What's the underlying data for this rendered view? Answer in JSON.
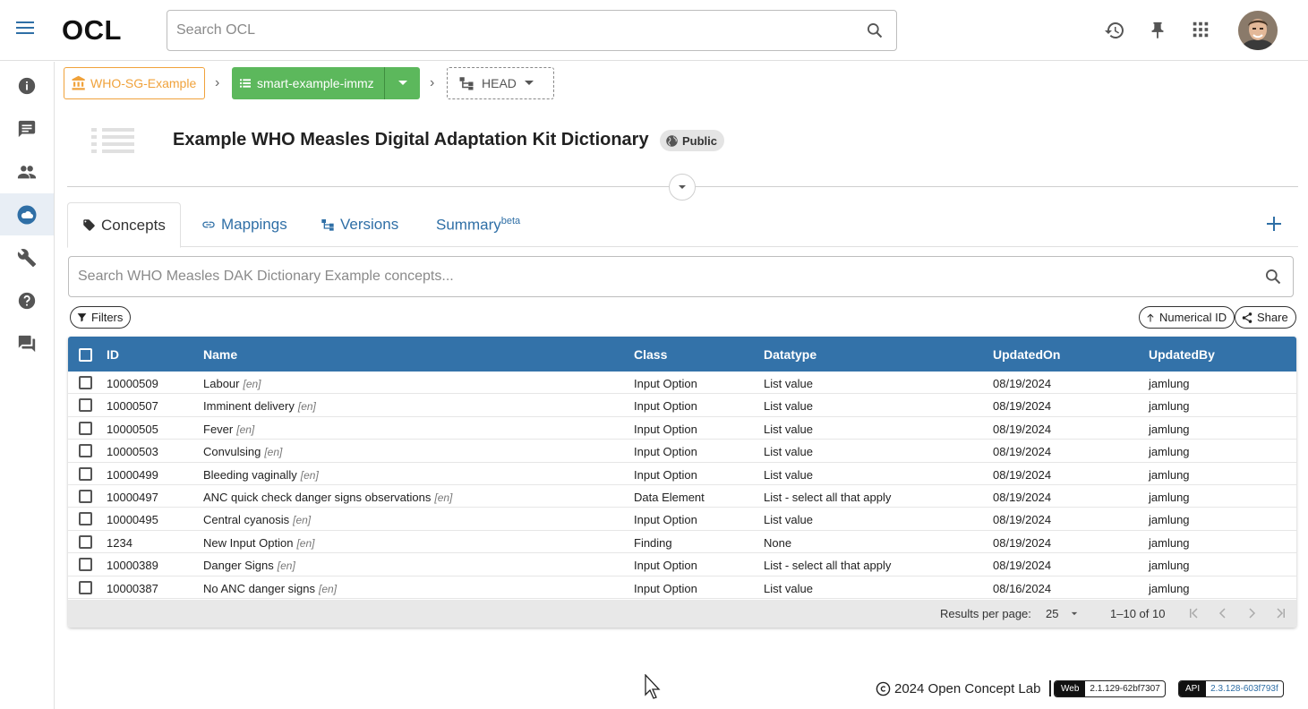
{
  "app": {
    "logo": "OCL"
  },
  "search": {
    "placeholder": "Search OCL"
  },
  "breadcrumb": {
    "org": "WHO-SG-Example",
    "source": "smart-example-immz",
    "version": "HEAD"
  },
  "header": {
    "title": "Example WHO Measles Digital Adaptation Kit Dictionary",
    "visibility": "Public"
  },
  "tabs": [
    {
      "label": "Concepts"
    },
    {
      "label": "Mappings"
    },
    {
      "label": "Versions"
    },
    {
      "label": "Summary",
      "sup": "beta"
    }
  ],
  "concept_search": {
    "placeholder": "Search WHO Measles DAK Dictionary Example concepts..."
  },
  "chips": {
    "filters": "Filters",
    "sort": "Numerical ID",
    "share": "Share"
  },
  "table": {
    "columns": [
      "ID",
      "Name",
      "Class",
      "Datatype",
      "UpdatedOn",
      "UpdatedBy"
    ],
    "rows": [
      {
        "id": "10000509",
        "name": "Labour",
        "lang": "[en]",
        "class": "Input Option",
        "datatype": "List value",
        "updated_on": "08/19/2024",
        "updated_by": "jamlung"
      },
      {
        "id": "10000507",
        "name": "Imminent delivery",
        "lang": "[en]",
        "class": "Input Option",
        "datatype": "List value",
        "updated_on": "08/19/2024",
        "updated_by": "jamlung"
      },
      {
        "id": "10000505",
        "name": "Fever",
        "lang": "[en]",
        "class": "Input Option",
        "datatype": "List value",
        "updated_on": "08/19/2024",
        "updated_by": "jamlung"
      },
      {
        "id": "10000503",
        "name": "Convulsing",
        "lang": "[en]",
        "class": "Input Option",
        "datatype": "List value",
        "updated_on": "08/19/2024",
        "updated_by": "jamlung"
      },
      {
        "id": "10000499",
        "name": "Bleeding vaginally",
        "lang": "[en]",
        "class": "Input Option",
        "datatype": "List value",
        "updated_on": "08/19/2024",
        "updated_by": "jamlung"
      },
      {
        "id": "10000497",
        "name": "ANC quick check danger signs observations",
        "lang": "[en]",
        "class": "Data Element",
        "datatype": "List - select all that apply",
        "updated_on": "08/19/2024",
        "updated_by": "jamlung"
      },
      {
        "id": "10000495",
        "name": "Central cyanosis",
        "lang": "[en]",
        "class": "Input Option",
        "datatype": "List value",
        "updated_on": "08/19/2024",
        "updated_by": "jamlung"
      },
      {
        "id": "1234",
        "name": "New Input Option",
        "lang": "[en]",
        "class": "Finding",
        "datatype": "None",
        "updated_on": "08/19/2024",
        "updated_by": "jamlung"
      },
      {
        "id": "10000389",
        "name": "Danger Signs",
        "lang": "[en]",
        "class": "Input Option",
        "datatype": "List - select all that apply",
        "updated_on": "08/19/2024",
        "updated_by": "jamlung"
      },
      {
        "id": "10000387",
        "name": "No ANC danger signs",
        "lang": "[en]",
        "class": "Input Option",
        "datatype": "List value",
        "updated_on": "08/16/2024",
        "updated_by": "jamlung"
      }
    ],
    "pagination": {
      "rows_label": "Results per page:",
      "rows_per_page": "25",
      "range": "1–10 of 10"
    }
  },
  "footer": {
    "copyright": "2024 Open Concept Lab",
    "web_label": "Web",
    "web_version": "2.1.129-62bf7307",
    "api_label": "API",
    "api_version": "2.3.128-603f793f"
  }
}
